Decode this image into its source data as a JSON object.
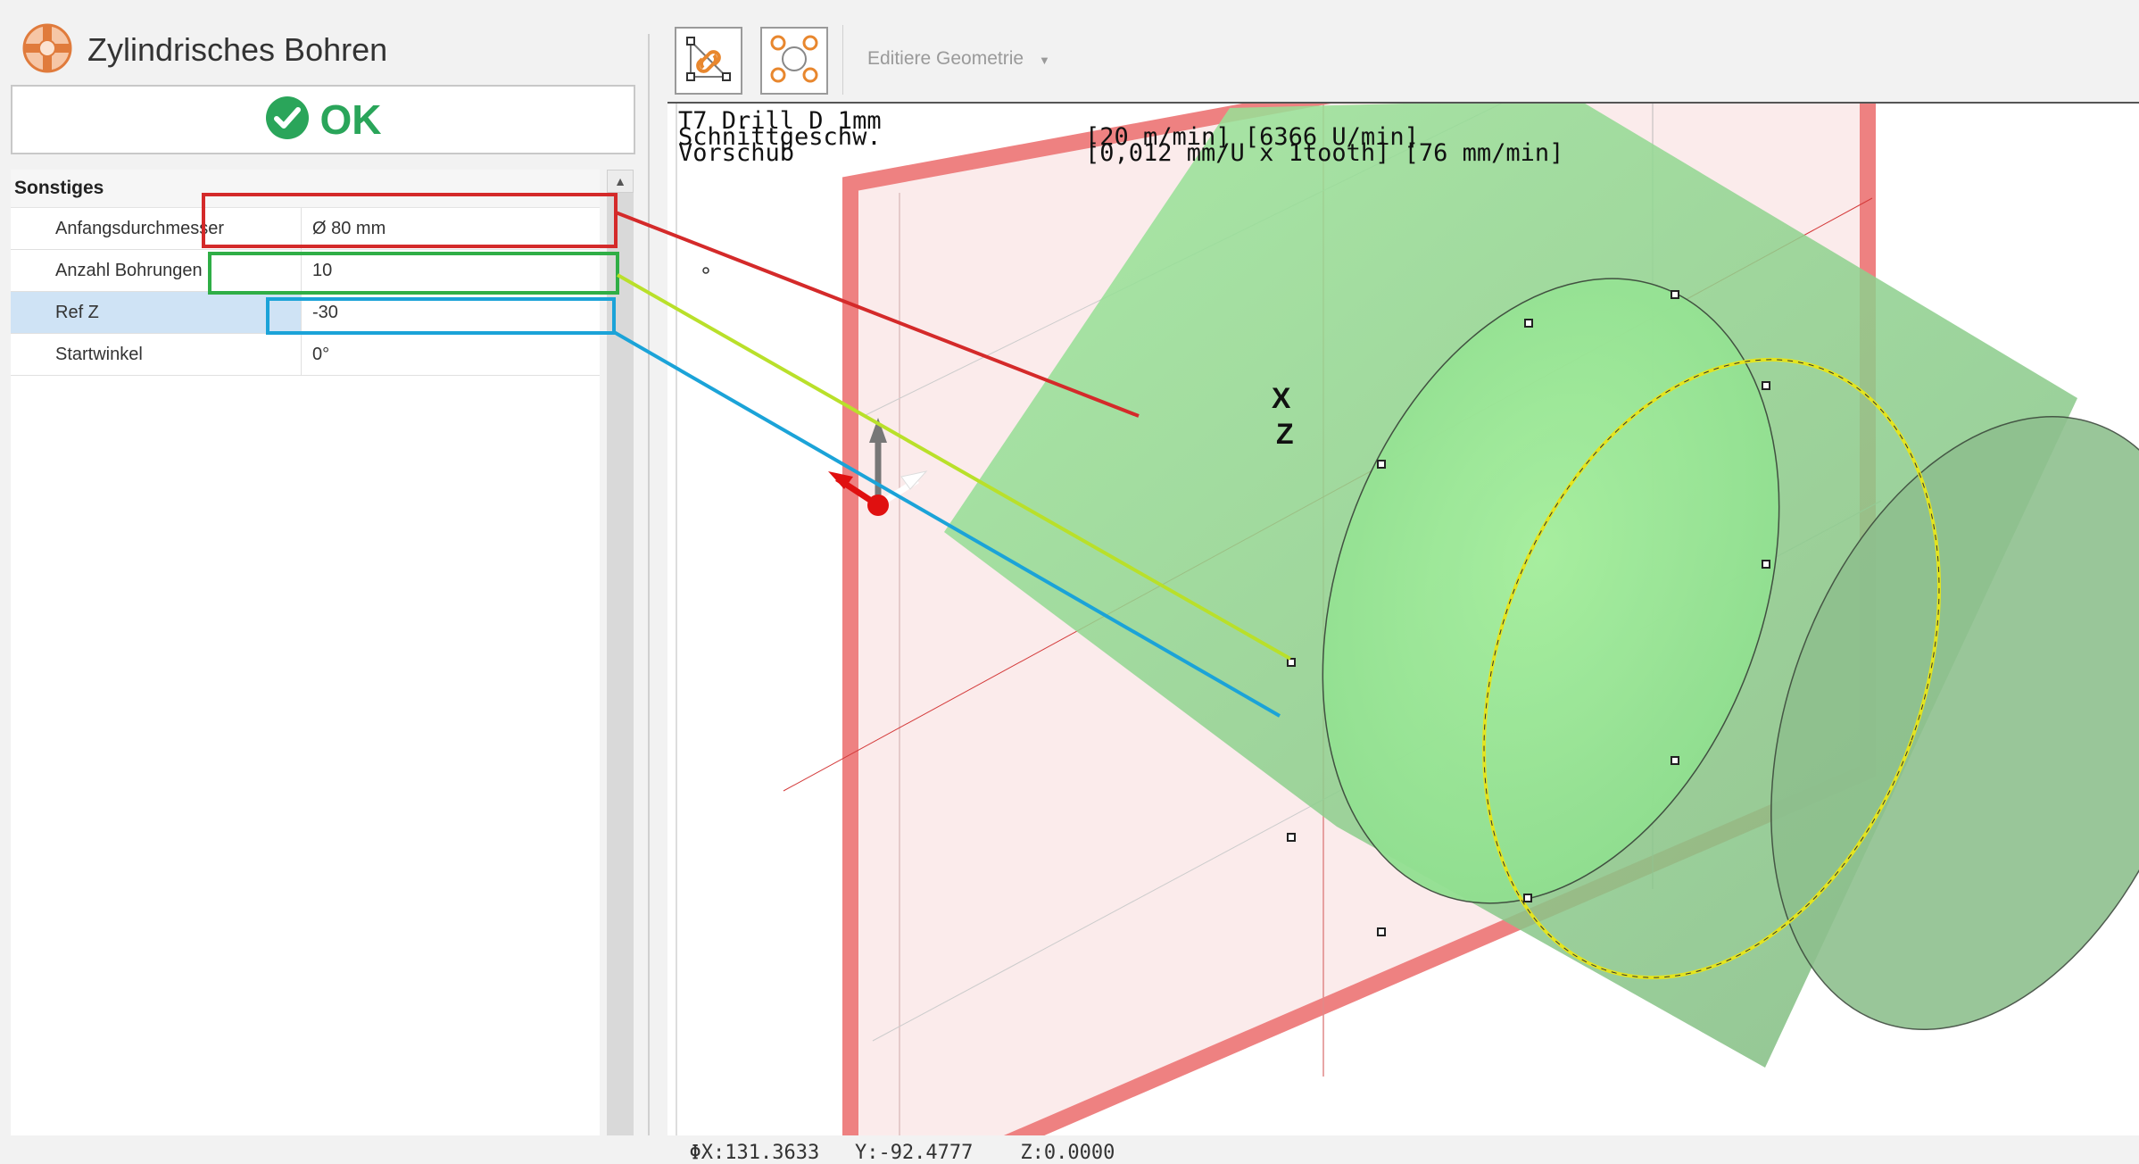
{
  "panel": {
    "title": "Zylindrisches Bohren",
    "ok_label": "OK",
    "group_label": "Sonstiges",
    "properties": [
      {
        "name": "Anfangsdurchmesser",
        "value": "Ø 80 mm"
      },
      {
        "name": "Anzahl Bohrungen",
        "value": "10"
      },
      {
        "name": "Ref Z",
        "value": "-30"
      },
      {
        "name": "Startwinkel",
        "value": "0°"
      }
    ],
    "selected_row": "Ref Z"
  },
  "toolbar": {
    "tool1_icon": "link-geometry-icon",
    "tool2_icon": "circle-pattern-icon",
    "edit_geometry_label": "Editiere Geometrie"
  },
  "hud": {
    "line1_left": "T7 Drill D 1mm",
    "line2_left": "Schnittgeschw.",
    "line3_left": "Vorschub",
    "line2_right": "[20 m/min] [6366 U/min]",
    "line3_right": "[0,012 mm/U x 1tooth] [76 mm/min]"
  },
  "axes": {
    "x_label": "X",
    "z_label": "Z"
  },
  "status": {
    "x": "ΦX:131.3633",
    "y": "Y:-92.4777",
    "z": "Z:0.0000"
  },
  "colors": {
    "ok_green": "#2aa55a",
    "annotation_red": "#d42a2a",
    "annotation_green": "#2fae46",
    "annotation_lime": "#b9e02a",
    "annotation_blue": "#1ba3d8",
    "cylinder_green": "#8fe08f",
    "plane_red": "#ee7b7b",
    "hole_circle": "#e4e41e"
  }
}
